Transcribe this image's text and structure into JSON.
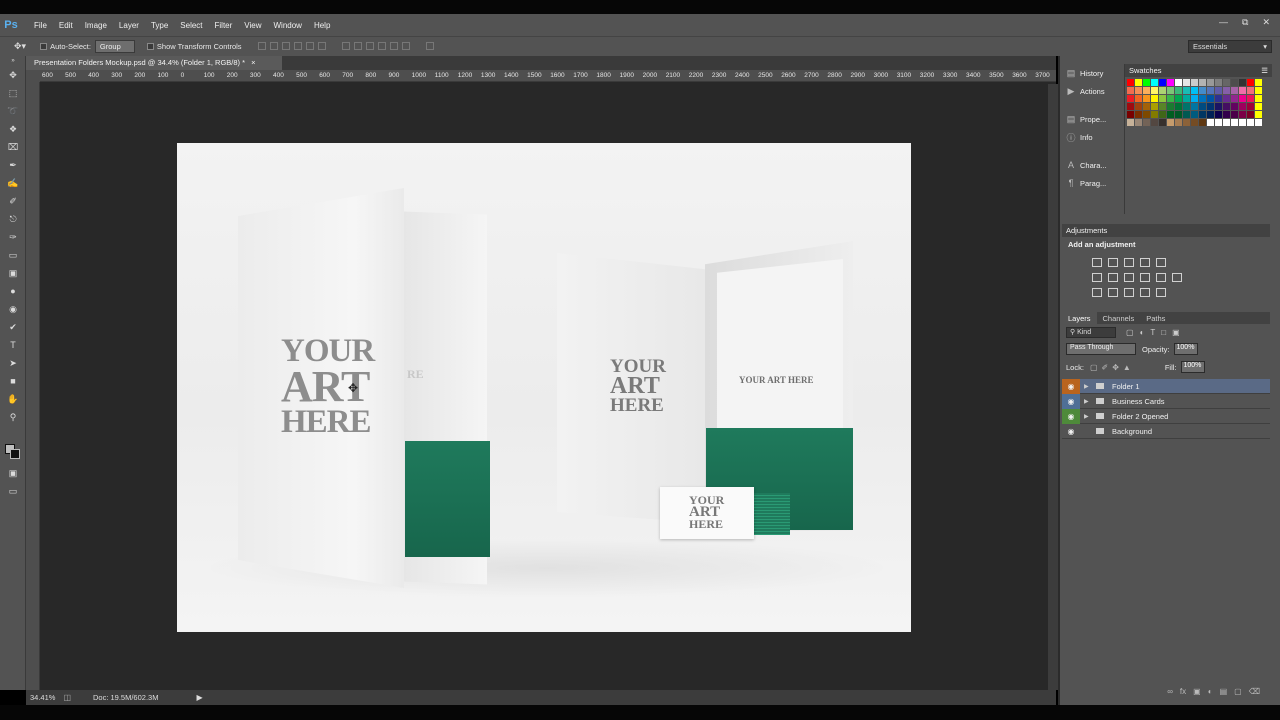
{
  "app": {
    "logo": "Ps"
  },
  "menu": [
    "File",
    "Edit",
    "Image",
    "Layer",
    "Type",
    "Select",
    "Filter",
    "View",
    "Window",
    "Help"
  ],
  "options": {
    "auto_select_label": "Auto-Select:",
    "auto_select_value": "Group",
    "show_transform_label": "Show Transform Controls",
    "workspace": "Essentials"
  },
  "document": {
    "tab_title": "Presentation Folders Mockup.psd @ 34.4% (Folder 1, RGB/8) *",
    "zoom": "34.41%",
    "doc_size": "Doc: 19.5M/602.3M"
  },
  "ruler_h": [
    "600",
    "500",
    "400",
    "300",
    "200",
    "100",
    "0",
    "100",
    "200",
    "300",
    "400",
    "500",
    "600",
    "700",
    "800",
    "900",
    "1000",
    "1100",
    "1200",
    "1300",
    "1400",
    "1500",
    "1600",
    "1700",
    "1800",
    "1900",
    "2000",
    "2100",
    "2200",
    "2300",
    "2400",
    "2500",
    "2600",
    "2700",
    "2800",
    "2900",
    "3000",
    "3100",
    "3200",
    "3300",
    "3400",
    "3500",
    "3600",
    "3700"
  ],
  "canvas": {
    "art_text_1": "YOUR",
    "art_text_2": "ART",
    "art_text_3": "HERE",
    "inner_partial": "RE",
    "art_right_1": "YOUR",
    "art_right_2": "ART",
    "art_right_3": "HERE",
    "art_right_inline": "YOUR ART HERE",
    "card_1": "YOUR",
    "card_2": "ART",
    "card_3": "HERE",
    "accent": "#1f7a5c"
  },
  "panels": {
    "strip": [
      {
        "label": "History",
        "icon": "history-icon"
      },
      {
        "label": "Actions",
        "icon": "actions-icon"
      },
      {
        "label": "Prope...",
        "icon": "properties-icon"
      },
      {
        "label": "Info",
        "icon": "info-icon"
      },
      {
        "label": "Chara...",
        "icon": "character-icon"
      },
      {
        "label": "Parag...",
        "icon": "paragraph-icon"
      }
    ],
    "swatches_title": "Swatches",
    "adjustments_title": "Adjustments",
    "adjustments_hint": "Add an adjustment",
    "layers_tabs": [
      "Layers",
      "Channels",
      "Paths"
    ],
    "kind_label": "Kind",
    "blend_mode": "Pass Through",
    "opacity_label": "Opacity:",
    "opacity_value": "100%",
    "lock_label": "Lock:",
    "fill_label": "Fill:",
    "fill_value": "100%",
    "layers": [
      {
        "name": "Folder 1",
        "color": "#b9641e",
        "selected": true
      },
      {
        "name": "Business Cards",
        "color": "#4f6f96",
        "selected": false
      },
      {
        "name": "Folder 2 Opened",
        "color": "#4e8a3a",
        "selected": false
      },
      {
        "name": "Background",
        "color": "",
        "selected": false
      }
    ]
  }
}
